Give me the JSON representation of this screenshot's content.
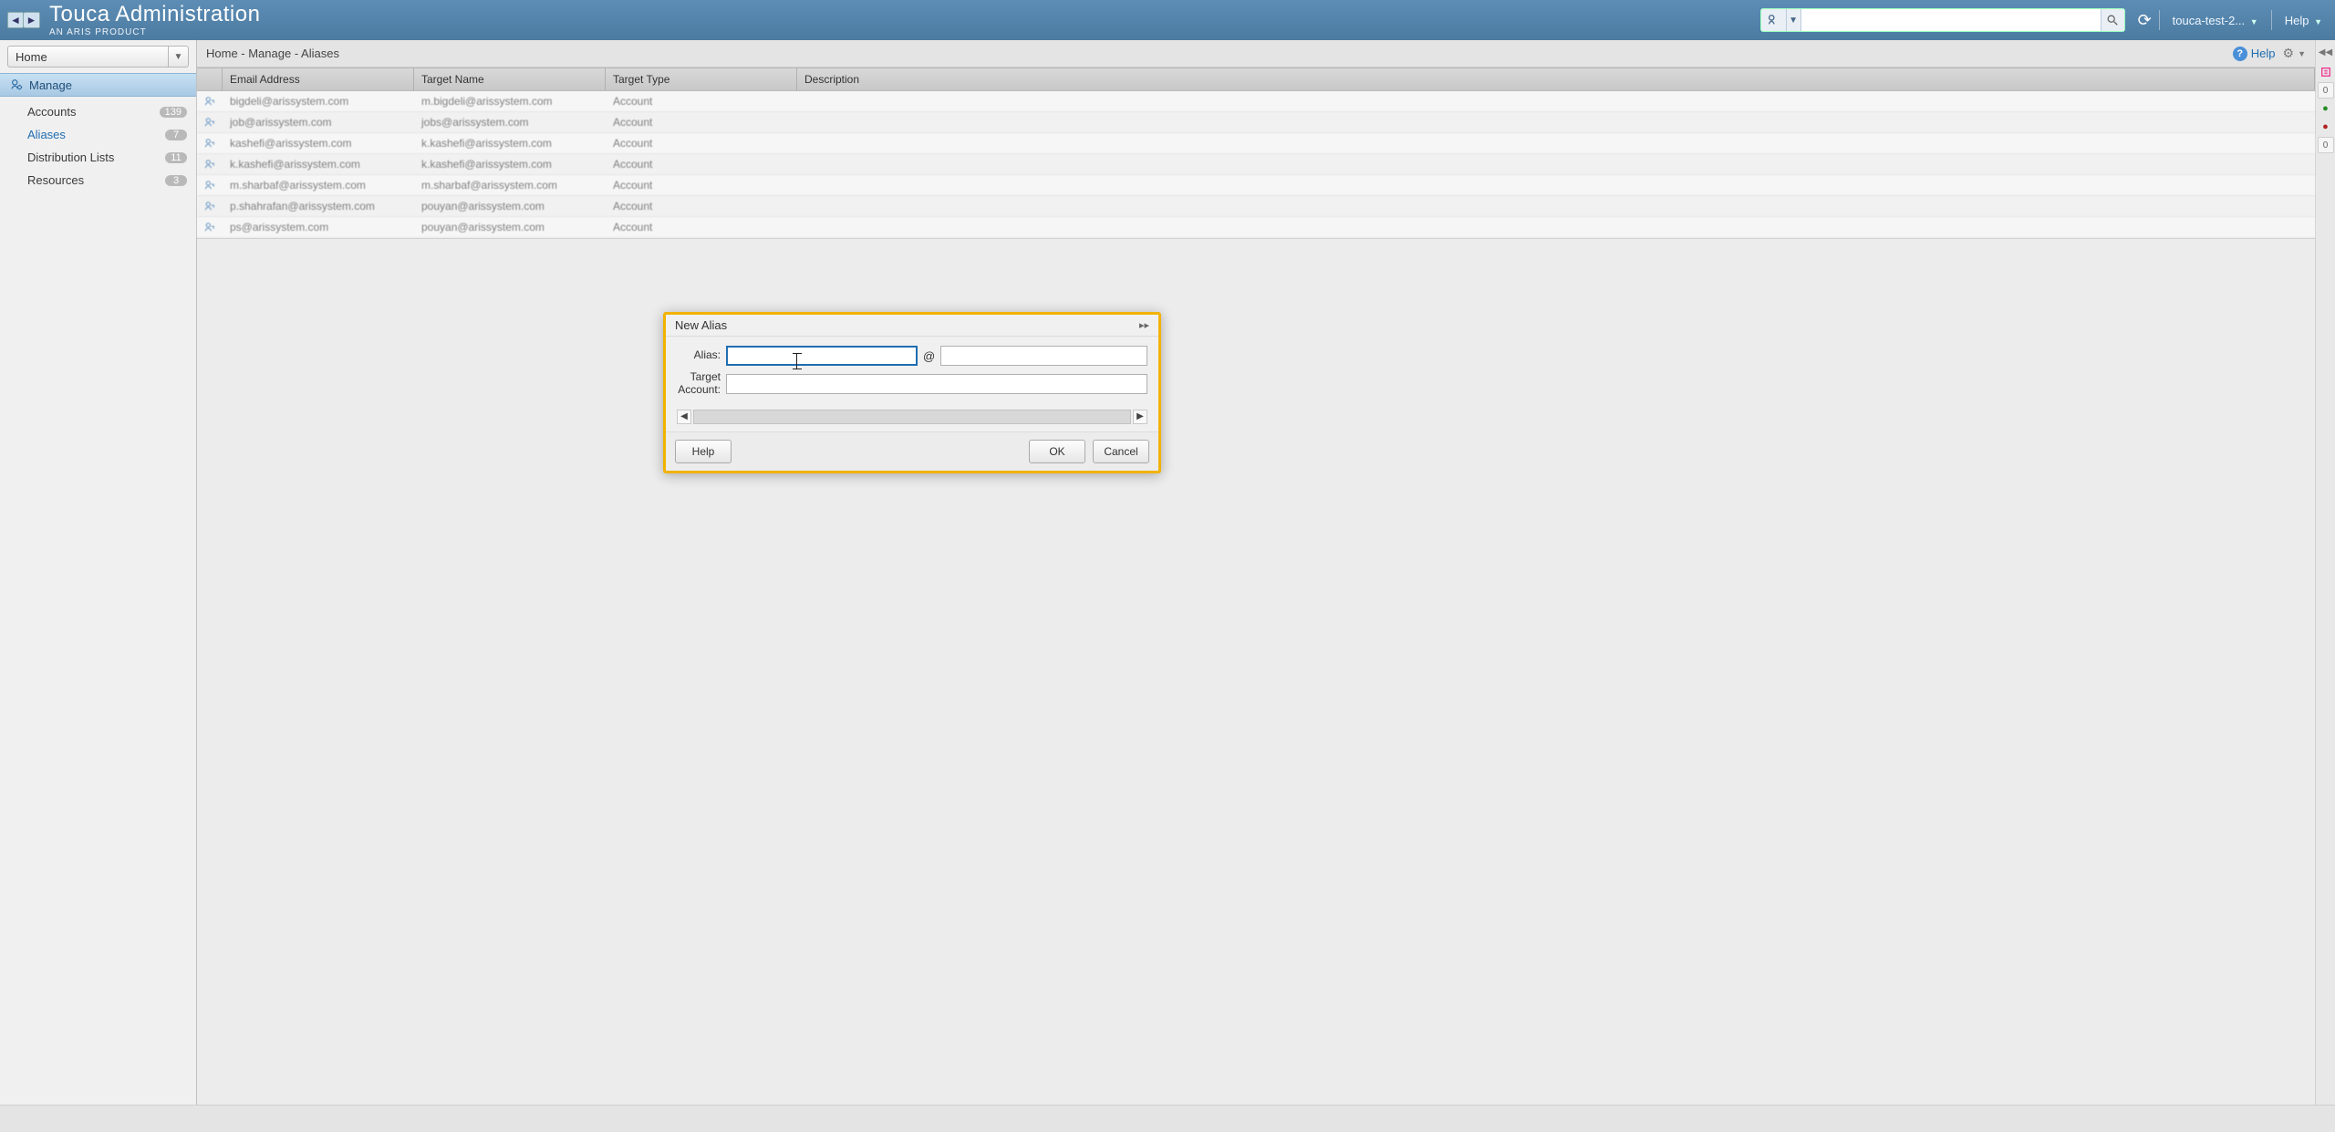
{
  "header": {
    "title": "Touca Administration",
    "subtitle": "AN ARIS PRODUCT",
    "search_value": "",
    "user_chip": "touca-test-2...",
    "help_label": "Help"
  },
  "sidebar": {
    "home_label": "Home",
    "section": "Manage",
    "items": [
      {
        "label": "Accounts",
        "badge": "139"
      },
      {
        "label": "Aliases",
        "badge": "7"
      },
      {
        "label": "Distribution Lists",
        "badge": "11"
      },
      {
        "label": "Resources",
        "badge": "3"
      }
    ],
    "selected_index": 1
  },
  "breadcrumb": "Home - Manage - Aliases",
  "main_help_label": "Help",
  "columns": {
    "email": "Email Address",
    "target": "Target Name",
    "type": "Target Type",
    "desc": "Description"
  },
  "rows": [
    {
      "email": "bigdeli@arissystem.com",
      "target": "m.bigdeli@arissystem.com",
      "type": "Account",
      "desc": ""
    },
    {
      "email": "job@arissystem.com",
      "target": "jobs@arissystem.com",
      "type": "Account",
      "desc": ""
    },
    {
      "email": "kashefi@arissystem.com",
      "target": "k.kashefi@arissystem.com",
      "type": "Account",
      "desc": ""
    },
    {
      "email": "k.kashefi@arissystem.com",
      "target": "k.kashefi@arissystem.com",
      "type": "Account",
      "desc": ""
    },
    {
      "email": "m.sharbaf@arissystem.com",
      "target": "m.sharbaf@arissystem.com",
      "type": "Account",
      "desc": ""
    },
    {
      "email": "p.shahrafan@arissystem.com",
      "target": "pouyan@arissystem.com",
      "type": "Account",
      "desc": ""
    },
    {
      "email": "ps@arissystem.com",
      "target": "pouyan@arissystem.com",
      "type": "Account",
      "desc": ""
    }
  ],
  "right_strip_counts": {
    "a": "0",
    "b": "0"
  },
  "dialog": {
    "title": "New Alias",
    "alias_label": "Alias:",
    "target_label_line1": "Target",
    "target_label_line2": "Account:",
    "alias_value": "",
    "domain_value": "",
    "target_value": "",
    "at": "@",
    "help": "Help",
    "ok": "OK",
    "cancel": "Cancel"
  }
}
